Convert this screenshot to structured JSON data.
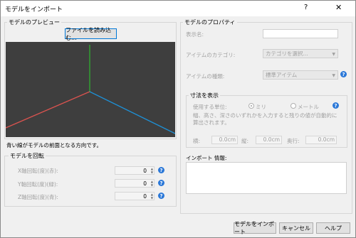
{
  "window": {
    "title": "モデルをインポート",
    "help_glyph": "?",
    "close_glyph": "✕"
  },
  "preview": {
    "group_label": "モデルのプレビュー",
    "load_button": "ファイルを読み込む...",
    "hint": "青い線がモデルの前面となる方向です。",
    "axis_colors": {
      "x": "#d9534f",
      "y": "#2fae2f",
      "z": "#1e90d6",
      "bg": "#3e3e3e"
    }
  },
  "rotation": {
    "group_label": "モデルを回転",
    "rows": [
      {
        "label": "X軸回転(度)(赤):",
        "value": "0"
      },
      {
        "label": "Y軸回転(度)(緑):",
        "value": "0"
      },
      {
        "label": "Z軸回転(度)(青):",
        "value": "0"
      }
    ]
  },
  "properties": {
    "group_label": "モデルのプロパティ",
    "name_label": "表示名:",
    "category_label": "アイテムのカテゴリ:",
    "category_value": "カテゴリを選択...",
    "type_label": "アイテムの種類:",
    "type_value": "標準アイテム"
  },
  "dimensions": {
    "group_label": "寸法を表示",
    "unit_label": "使用する単位:",
    "unit_mm": "ミリ",
    "unit_m": "メートル",
    "description": "幅、高さ、深さのいずれかを入力すると残りの値が自動的に算出されます。",
    "width_label": "横:",
    "width_value": "0.0cm",
    "height_label": "縦:",
    "height_value": "0.0cm",
    "depth_label": "奥行:",
    "depth_value": "0.0cm"
  },
  "import_info": {
    "label": "インポート 情報:"
  },
  "footer": {
    "import_button": "モデルをインポート",
    "cancel_button": "キャンセル",
    "help_button": "ヘルプ"
  }
}
